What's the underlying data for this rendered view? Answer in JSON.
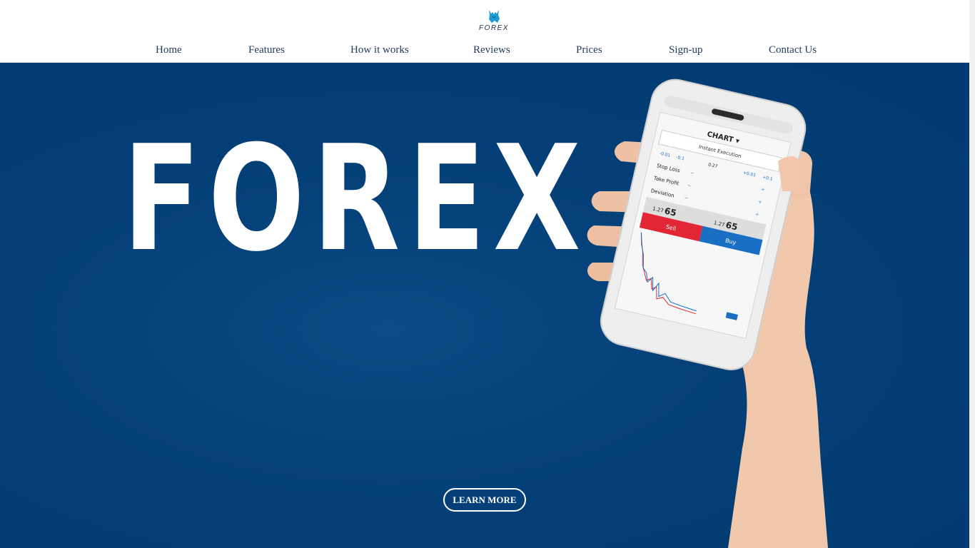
{
  "brand": {
    "logo_text": "FOREX",
    "logo_icon": "bull-icon",
    "accent_color": "#1e9ad6"
  },
  "nav": {
    "items": [
      {
        "label": "Home"
      },
      {
        "label": "Features"
      },
      {
        "label": "How it works"
      },
      {
        "label": "Reviews"
      },
      {
        "label": "Prices"
      },
      {
        "label": "Sign-up"
      },
      {
        "label": "Contact Us"
      }
    ]
  },
  "hero": {
    "title": "FOREX",
    "background_color": "#003a70",
    "cta_label": "LEARN MORE"
  },
  "phone_screen": {
    "header": "CHART ▾",
    "mode": "Instant Execution",
    "steps": [
      "-0.01",
      "-0.1",
      "0.27",
      "+0.01",
      "+0.1"
    ],
    "rows": [
      "Stop Loss",
      "Take Profit",
      "Deviation"
    ],
    "sell_price_prefix": "1.27",
    "sell_price_big": "65",
    "buy_price_prefix": "1.27",
    "buy_price_big": "65",
    "sell_label": "Sell",
    "buy_label": "Buy",
    "sell_color": "#e32636",
    "buy_color": "#1a6fc4"
  }
}
